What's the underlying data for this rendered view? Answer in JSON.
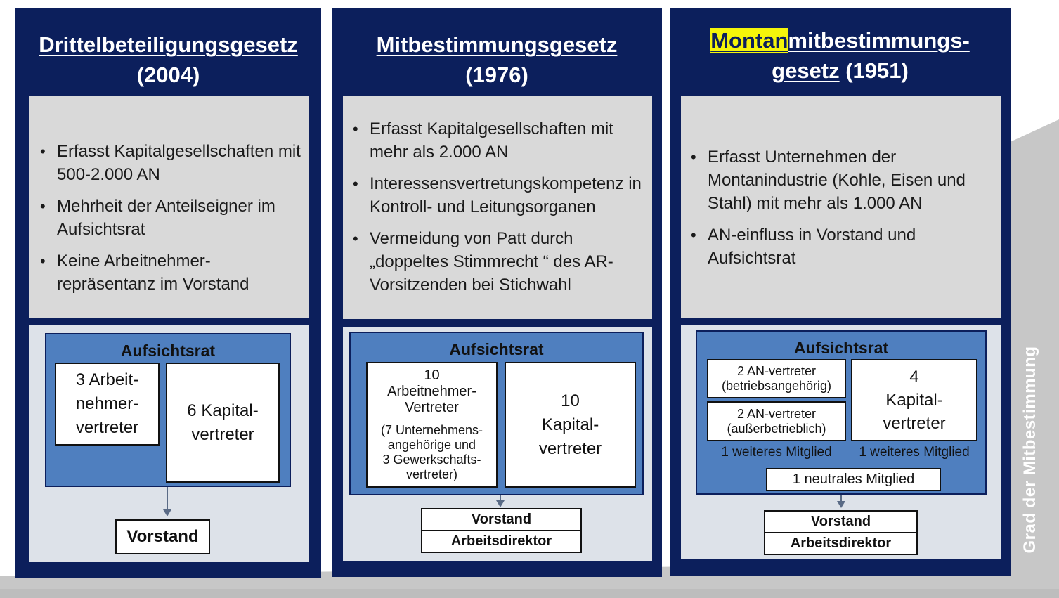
{
  "side_label": "Grad der Mitbestimmung",
  "columns": [
    {
      "title_line1": "Drittelbeteiligungsgesetz",
      "title_line2": "(2004)",
      "bullets": [
        "Erfasst Kapitalgesellschaften mit 500-2.000 AN",
        "Mehrheit der Anteilseigner im Aufsichtsrat",
        "Keine Arbeitnehmer-repräsentanz im Vorstand"
      ],
      "board_title": "Aufsichtsrat",
      "employee_box": [
        "3 Arbeit-",
        "nehmer-",
        "vertreter"
      ],
      "capital_box": [
        "6 Kapital-",
        "vertreter"
      ],
      "exec_boxes": [
        "Vorstand"
      ]
    },
    {
      "title_line1": "Mitbestimmungsgesetz",
      "title_line2": "(1976)",
      "bullets": [
        "Erfasst Kapitalgesellschaften mit mehr als 2.000 AN",
        "Interessensvertretungskompetenz in Kontroll- und Leitungsorganen",
        "Vermeidung von Patt durch „doppeltes Stimmrecht “ des AR-Vorsitzenden bei Stichwahl"
      ],
      "board_title": "Aufsichtsrat",
      "employee_box": [
        "10",
        "Arbeitnehmer-",
        "Vertreter"
      ],
      "employee_note": [
        "(7 Unternehmens-",
        "angehörige und",
        "3 Gewerkschafts-",
        "vertreter)"
      ],
      "capital_box": [
        "10",
        "Kapital-",
        "vertreter"
      ],
      "exec_boxes": [
        "Vorstand",
        "Arbeitsdirektor"
      ]
    },
    {
      "title_highlight": "Montan",
      "title_rest1": "mitbestimmungs-",
      "title_line2_u": "gesetz",
      "title_line2_rest": " (1951)",
      "bullets": [
        "Erfasst Unternehmen der Montanindustrie (Kohle, Eisen und Stahl) mit mehr als 1.000 AN",
        "AN-einfluss in Vorstand und Aufsichtsrat"
      ],
      "board_title": "Aufsichtsrat",
      "an_box1": [
        "2 AN-vertreter",
        "(betriebsangehörig)"
      ],
      "an_box2": [
        "2 AN-vertreter",
        "(außerbetrieblich)"
      ],
      "capital_box": [
        "4",
        "Kapital-",
        "vertreter"
      ],
      "extra_left": "1 weiteres Mitglied",
      "extra_right": "1 weiteres Mitglied",
      "neutral": "1 neutrales Mitglied",
      "exec_boxes": [
        "Vorstand",
        "Arbeitsdirektor"
      ]
    }
  ],
  "colors": {
    "navy": "#0c1f5c",
    "info_grey": "#d9d9d9",
    "board_blue": "#4f7fbf",
    "ramp_grey": "#c7c7c7",
    "highlight": "#f5f50a"
  }
}
